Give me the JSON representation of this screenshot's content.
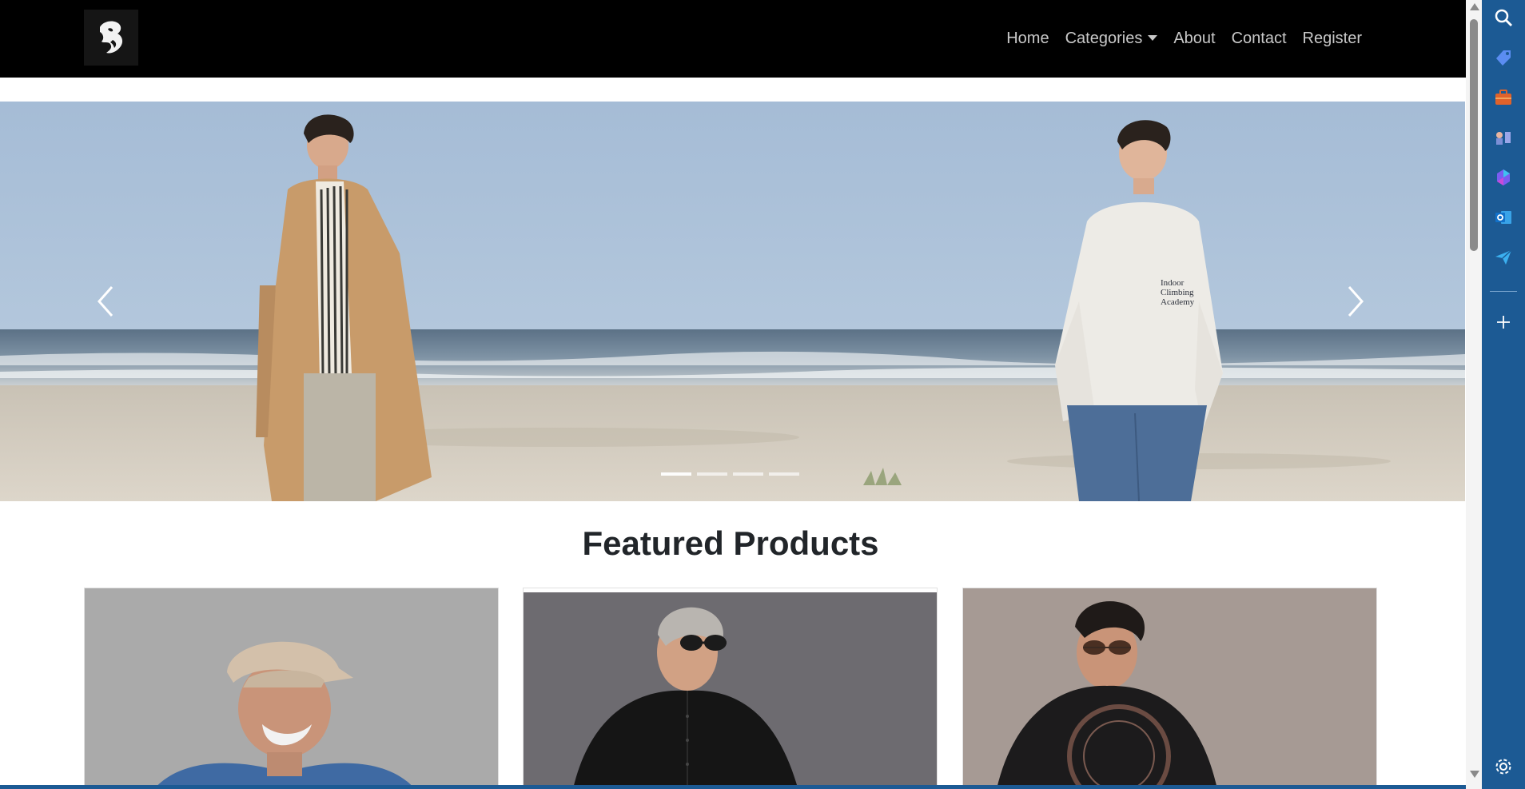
{
  "navbar": {
    "logo_alt": "brand-logo",
    "links": {
      "home": "Home",
      "categories": "Categories",
      "about": "About",
      "contact": "Contact",
      "register": "Register"
    }
  },
  "carousel": {
    "slide_count": 4,
    "active_index": 0,
    "sweatshirt_print": "Indoor Climbing Academy"
  },
  "featured": {
    "title": "Featured Products",
    "products": [
      {
        "name": "model-in-cap-blue-tshirt"
      },
      {
        "name": "model-black-shirt-sunglasses"
      },
      {
        "name": "model-black-sweatshirt-print"
      }
    ]
  },
  "colors": {
    "navbar_bg": "#000000",
    "nav_text": "#c8c8c8",
    "edge_sidebar": "#1c5a94",
    "title_text": "#212529"
  },
  "edge_sidebar": {
    "icons": [
      "search-icon",
      "tag-icon",
      "briefcase-icon",
      "games-icon",
      "copilot-icon",
      "outlook-icon",
      "send-icon",
      "add-icon",
      "settings-icon"
    ]
  }
}
